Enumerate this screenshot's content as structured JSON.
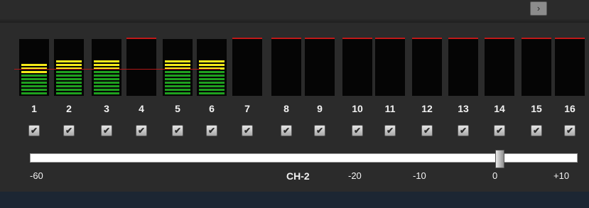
{
  "top": {
    "corner_icon": "chevron-right-icon",
    "corner_glyph": "›"
  },
  "channels": [
    {
      "number": "1",
      "level": 0.72,
      "checked": true
    },
    {
      "number": "2",
      "level": 0.75,
      "checked": true
    },
    {
      "number": "3",
      "level": 0.75,
      "checked": true
    },
    {
      "number": "4",
      "level": 0.0,
      "checked": true
    },
    {
      "number": "5",
      "level": 0.75,
      "checked": true
    },
    {
      "number": "6",
      "level": 0.75,
      "checked": true
    },
    {
      "number": "7",
      "level": 0.0,
      "checked": true
    },
    {
      "number": "8",
      "level": 0.0,
      "checked": true
    },
    {
      "number": "9",
      "level": 0.0,
      "checked": true
    },
    {
      "number": "10",
      "level": 0.0,
      "checked": true
    },
    {
      "number": "11",
      "level": 0.0,
      "checked": true
    },
    {
      "number": "12",
      "level": 0.0,
      "checked": true
    },
    {
      "number": "13",
      "level": 0.0,
      "checked": true
    },
    {
      "number": "14",
      "level": 0.0,
      "checked": true
    },
    {
      "number": "15",
      "level": 0.0,
      "checked": true
    },
    {
      "number": "16",
      "level": 0.0,
      "checked": true
    }
  ],
  "checkmark": "✔",
  "slider": {
    "value_db": 0,
    "min_db": -60,
    "max_db": 10
  },
  "scale": {
    "min": "-60",
    "channel": "CH-2",
    "m20": "-20",
    "m10": "-10",
    "zero": "0",
    "max": "+10"
  },
  "colors": {
    "green": "#1fa01f",
    "yellow": "#f3ea1a",
    "peak": "#c01818"
  }
}
